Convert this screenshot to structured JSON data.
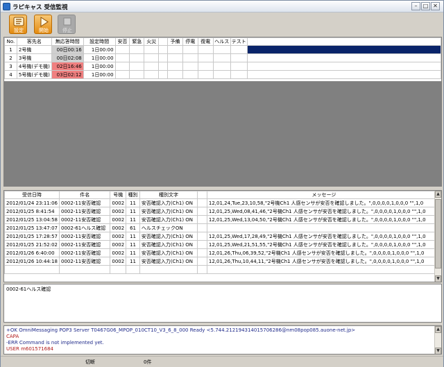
{
  "window": {
    "title": "ラピキャス 受信監視",
    "controls": {
      "minimize": "–",
      "maximize": "□",
      "close": "✕"
    }
  },
  "toolbar": {
    "buttons": [
      {
        "label": "設定",
        "icon": "settings-icon",
        "state": "enabled"
      },
      {
        "label": "開始",
        "icon": "play-icon",
        "state": "enabled"
      },
      {
        "label": "停止",
        "icon": "stop-icon",
        "state": "disabled"
      }
    ]
  },
  "monitor_grid": {
    "columns": [
      "No.",
      "客先名",
      "無応答時間",
      "設定時間",
      "安否",
      "緊急",
      "火災",
      "",
      "予備",
      "停電",
      "復電",
      "ヘルス",
      "テスト"
    ],
    "rows": [
      {
        "no": "1",
        "name": "2号機",
        "elapsed": "00日00:16",
        "setting": "1日00:00",
        "flag": "",
        "selected": true
      },
      {
        "no": "2",
        "name": "3号機",
        "elapsed": "00日02:08",
        "setting": "1日00:00",
        "flag": "",
        "selected": false
      },
      {
        "no": "3",
        "name": "4号機(デモ機)",
        "elapsed": "02日16:46",
        "setting": "1日00:00",
        "flag": "alert",
        "selected": false
      },
      {
        "no": "4",
        "name": "5号機(デモ機)",
        "elapsed": "03日02:12",
        "setting": "1日00:00",
        "flag": "alert",
        "selected": false
      }
    ]
  },
  "log_grid": {
    "columns": [
      "受信日時",
      "件名",
      "号機",
      "種別",
      "種別文字",
      "",
      "メッセージ"
    ],
    "rows": [
      {
        "datetime": "2012/01/24 23:11:06",
        "subject": "0002-11安否確認",
        "unit": "0002",
        "kind": "11",
        "kind_text": "安否確認入力(Ch1) ON",
        "message": "12,01,24,Tue,23,10,58,\"2号機Ch1 人感センサが安否を確認しました。\",0,0,0,0,1,0,0,0 \"\",1,0"
      },
      {
        "datetime": "2012/01/25 8:41:54",
        "subject": "0002-11安否確認",
        "unit": "0002",
        "kind": "11",
        "kind_text": "安否確認入力(Ch1) ON",
        "message": "12,01,25,Wed,08,41,46,\"2号機Ch1 人感センサが安否を確認しました。\",0,0,0,0,1,0,0,0 \"\",1,0"
      },
      {
        "datetime": "2012/01/25 13:04:58",
        "subject": "0002-11安否確認",
        "unit": "0002",
        "kind": "11",
        "kind_text": "安否確認入力(Ch1) ON",
        "message": "12,01,25,Wed,13,04,50,\"2号機Ch1 人感センサが安否を確認しました。\",0,0,0,0,1,0,0,0 \"\",1,0"
      },
      {
        "datetime": "2012/01/25 13:47:07",
        "subject": "0002-61ヘルス確認",
        "unit": "0002",
        "kind": "61",
        "kind_text": "ヘルスチェックON",
        "message": ""
      },
      {
        "datetime": "2012/01/25 17:28:57",
        "subject": "0002-11安否確認",
        "unit": "0002",
        "kind": "11",
        "kind_text": "安否確認入力(Ch1) ON",
        "message": "12,01,25,Wed,17,28,49,\"2号機Ch1 人感センサが安否を確認しました。\",0,0,0,0,1,0,0,0 \"\",1,0"
      },
      {
        "datetime": "2012/01/25 21:52:02",
        "subject": "0002-11安否確認",
        "unit": "0002",
        "kind": "11",
        "kind_text": "安否確認入力(Ch1) ON",
        "message": "12,01,25,Wed,21,51,55,\"2号機Ch1 人感センサが安否を確認しました。\",0,0,0,0,1,0,0,0 \"\",1,0"
      },
      {
        "datetime": "2012/01/26 6:40:00",
        "subject": "0002-11安否確認",
        "unit": "0002",
        "kind": "11",
        "kind_text": "安否確認入力(Ch1) ON",
        "message": "12,01,26,Thu,06,39,52,\"2号機Ch1 人感センサが安否を確認しました。\",0,0,0,0,1,0,0,0 \"\",1,0"
      },
      {
        "datetime": "2012/01/26 10:44:18",
        "subject": "0002-11安否確認",
        "unit": "0002",
        "kind": "11",
        "kind_text": "安否確認入力(Ch1) ON",
        "message": "12,01,26,Thu,10,44,11,\"2号機Ch1 人感センサが安否を確認しました。\",0,0,0,0,1,0,0,0 \"\",1,0"
      },
      {
        "datetime": "2012/01/26 13:47:05",
        "subject": "0002-61ヘルス確認",
        "unit": "0002",
        "kind": "61",
        "kind_text": "ヘルスチェックON",
        "message": "",
        "selected": true
      }
    ]
  },
  "detail_text": "0002-61ヘルス確認",
  "server_log": [
    {
      "text": "+OK OmniMessaging POP3 Server T0467G06_MPOP_010CT10_V3_6_8_000 Ready <5.744.212194314015706286@nm08pop085.auone-net.jp>",
      "color": "#1f2a8a"
    },
    {
      "text": "CAPA",
      "color": "#b01818"
    },
    {
      "text": "-ERR Command is not implemented yet.",
      "color": "#1f2a8a"
    },
    {
      "text": "USER m601571684",
      "color": "#b01818"
    }
  ],
  "statusbar": {
    "connection": "切断",
    "count": "0件"
  },
  "colors": {
    "selection": "#0a246a",
    "alert": "#f08080",
    "toolbar_orange": "#e48b10"
  }
}
